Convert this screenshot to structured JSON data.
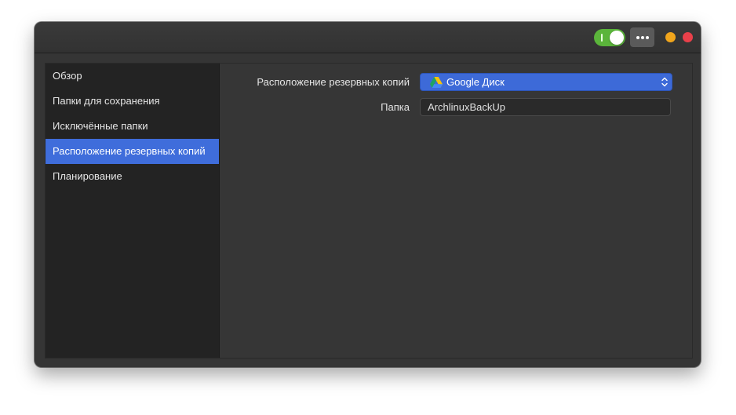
{
  "sidebar": {
    "items": [
      {
        "label": "Обзор"
      },
      {
        "label": "Папки для сохранения"
      },
      {
        "label": "Исключённые папки"
      },
      {
        "label": "Расположение резервных копий"
      },
      {
        "label": "Планирование"
      }
    ],
    "active_index": 3
  },
  "form": {
    "location_label": "Расположение резервных копий",
    "location_value": "Google Диск",
    "location_icon": "google-drive-icon",
    "folder_label": "Папка",
    "folder_value": "ArchlinuxBackUp"
  },
  "titlebar": {
    "toggle_state": "on",
    "menu_icon": "more-options-icon"
  },
  "colors": {
    "accent": "#3f6ddb",
    "toggle_on": "#5bb53b",
    "minimize": "#f0a51c",
    "close": "#e9404a",
    "window_bg": "#353535",
    "sidebar_bg": "#232323"
  }
}
